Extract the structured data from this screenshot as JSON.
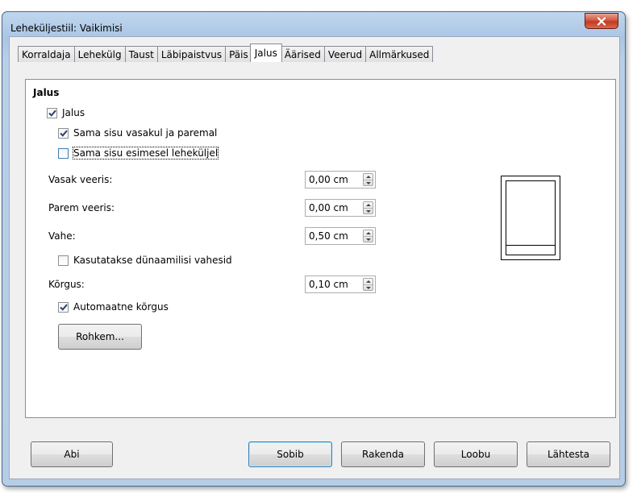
{
  "window": {
    "title": "Leheküljestiil: Vaikimisi"
  },
  "tabs": [
    {
      "label": "Korraldaja",
      "active": false
    },
    {
      "label": "Lehekülg",
      "active": false
    },
    {
      "label": "Taust",
      "active": false
    },
    {
      "label": "Läbipaistvus",
      "active": false
    },
    {
      "label": "Päis",
      "active": false
    },
    {
      "label": "Jalus",
      "active": true
    },
    {
      "label": "Äärised",
      "active": false
    },
    {
      "label": "Veerud",
      "active": false
    },
    {
      "label": "Allmärkused",
      "active": false
    }
  ],
  "footer_section": {
    "title": "Jalus",
    "footer_on": {
      "label": "Jalus",
      "checked": true
    },
    "same_left_right": {
      "label": "Sama sisu vasakul ja paremal",
      "checked": true
    },
    "same_first_page": {
      "label": "Sama sisu esimesel leheküljel",
      "checked": false
    },
    "left_margin": {
      "label": "Vasak veeris:",
      "value": "0,00 cm"
    },
    "right_margin": {
      "label": "Parem veeris:",
      "value": "0,00 cm"
    },
    "spacing": {
      "label": "Vahe:",
      "value": "0,50 cm"
    },
    "dynamic_spacing": {
      "label": "Kasutatakse dünaamilisi vahesid",
      "checked": false
    },
    "height": {
      "label": "Kõrgus:",
      "value": "0,10 cm"
    },
    "auto_height": {
      "label": "Automaatne kõrgus",
      "checked": true
    },
    "more_button": "Rohkem..."
  },
  "buttons": {
    "help": "Abi",
    "ok": "Sobib",
    "apply": "Rakenda",
    "cancel": "Loobu",
    "reset": "Lähtesta"
  },
  "colors": {
    "title_bar": "#aac6e4",
    "close_button": "#c23a20",
    "dialog_bg": "#f0f0f0",
    "default_button_border": "#3c7fb1"
  }
}
